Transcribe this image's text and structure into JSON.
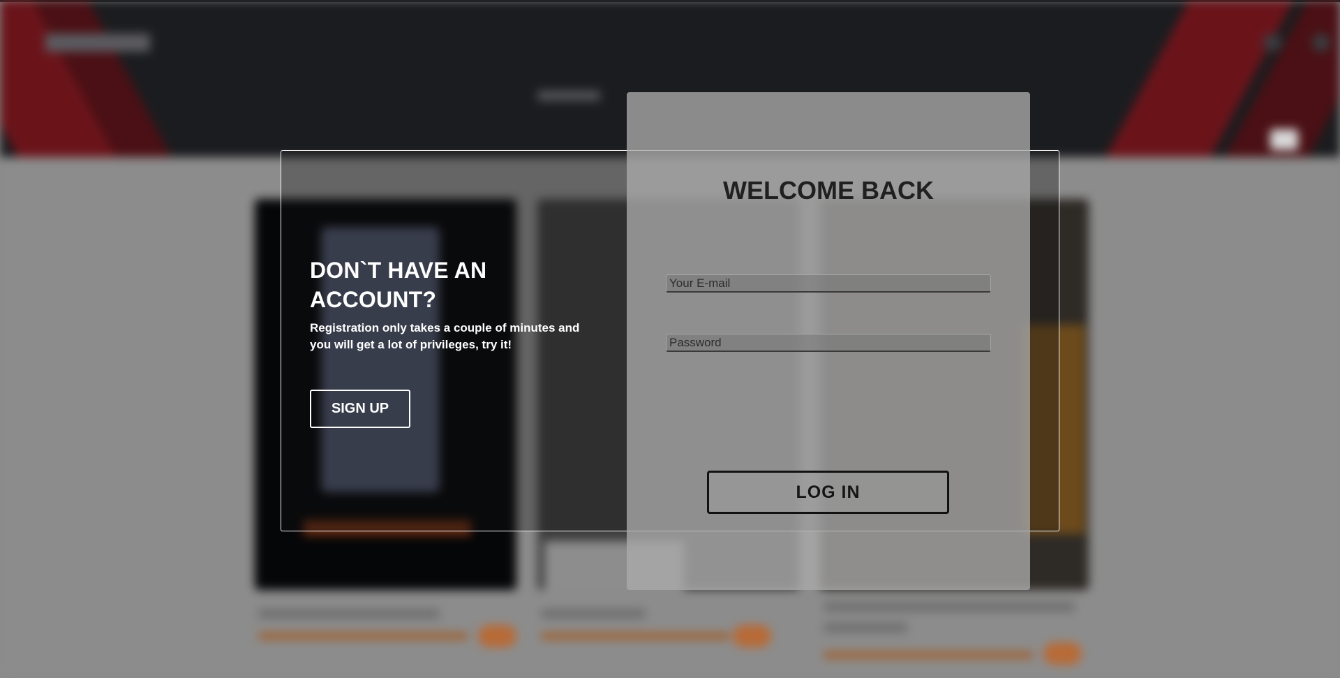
{
  "signup_panel": {
    "title": "DON`T HAVE AN ACCOUNT?",
    "description": "Registration only takes a couple of minutes and you will get a lot of privileges, try it!",
    "signup_label": "SIGN UP"
  },
  "login_panel": {
    "title": "WELCOME BACK",
    "email_placeholder": "Your E-mail",
    "password_placeholder": "Password",
    "login_label": "LOG IN"
  },
  "colors": {
    "header_dark": "#1b1c1f",
    "accent_red": "#6a141a",
    "accent_orange": "#b86a36"
  }
}
